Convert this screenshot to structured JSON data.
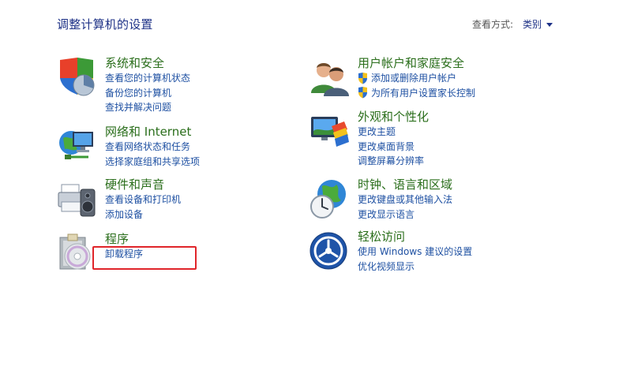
{
  "header": {
    "title": "调整计算机的设置",
    "view_by_label": "查看方式:",
    "view_by_value": "类别"
  },
  "categories": [
    {
      "title": "系统和安全",
      "icon": "shield-pie-icon",
      "links": [
        "查看您的计算机状态",
        "备份您的计算机",
        "查找并解决问题"
      ]
    },
    {
      "title": "网络和 Internet",
      "icon": "globe-network-icon",
      "links": [
        "查看网络状态和任务",
        "选择家庭组和共享选项"
      ]
    },
    {
      "title": "硬件和声音",
      "icon": "printer-speaker-icon",
      "links": [
        "查看设备和打印机",
        "添加设备"
      ]
    },
    {
      "title": "程序",
      "icon": "programs-disc-icon",
      "links": [
        "卸载程序"
      ]
    },
    {
      "title": "用户帐户和家庭安全",
      "icon": "users-icon",
      "links": [
        "添加或删除用户帐户",
        "为所有用户设置家长控制"
      ]
    },
    {
      "title": "外观和个性化",
      "icon": "monitor-palette-icon",
      "links": [
        "更改主题",
        "更改桌面背景",
        "调整屏幕分辨率"
      ]
    },
    {
      "title": "时钟、语言和区域",
      "icon": "globe-clock-icon",
      "links": [
        "更改键盘或其他输入法",
        "更改显示语言"
      ]
    },
    {
      "title": "轻松访问",
      "icon": "ease-of-access-icon",
      "links": [
        "使用 Windows 建议的设置",
        "优化视频显示"
      ]
    }
  ],
  "colors": {
    "title": "#1e3287",
    "category_title": "#2a6e1b",
    "link": "#1e50a2",
    "highlight": "#e0252a"
  }
}
